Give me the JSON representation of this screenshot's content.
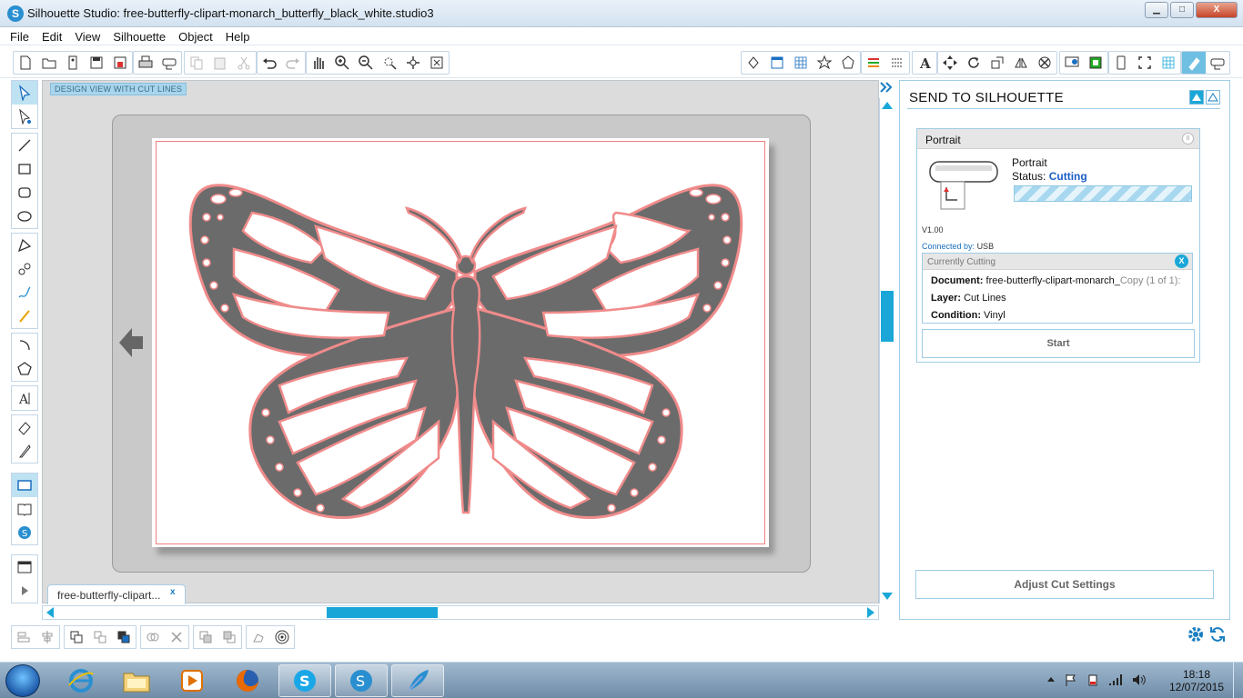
{
  "window": {
    "title": "Silhouette Studio: free-butterfly-clipart-monarch_butterfly_black_white.studio3",
    "minimize": "▁",
    "maximize": "□",
    "close": "X"
  },
  "menu": [
    "File",
    "Edit",
    "View",
    "Silhouette",
    "Object",
    "Help"
  ],
  "canvas": {
    "view_label": "DESIGN VIEW WITH CUT LINES",
    "doc_tab": "free-butterfly-clipart...",
    "doc_tab_close": "x"
  },
  "colors": {
    "accent": "#1aa7d8",
    "cut_line": "#f08b8b",
    "butterfly_fill": "#6b6b6b"
  },
  "panel": {
    "title": "SEND TO SILHOUETTE",
    "device": {
      "header": "Portrait",
      "name": "Portrait",
      "status_label": "Status:",
      "status_value": "Cutting",
      "version": "V1.00",
      "connected_label": "Connected by:",
      "connected_value": "USB"
    },
    "currently_cutting": {
      "header": "Currently Cutting",
      "close": "X",
      "document_label": "Document:",
      "document_value": "free-butterfly-clipart-monarch_",
      "document_copy": "Copy (1 of 1):",
      "layer_label": "Layer:",
      "layer_value": "Cut Lines",
      "condition_label": "Condition:",
      "condition_value": "Vinyl"
    },
    "start_button": "Start",
    "adjust_button": "Adjust Cut Settings"
  },
  "taskbar": {
    "time": "18:18",
    "date": "12/07/2015"
  }
}
